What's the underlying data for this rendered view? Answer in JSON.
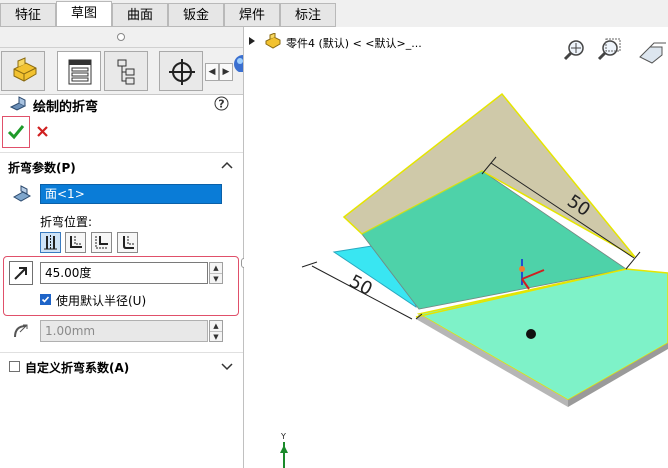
{
  "tabs": [
    "特征",
    "草图",
    "曲面",
    "钣金",
    "焊件",
    "标注"
  ],
  "active_tab": 1,
  "panel_tabs": [
    "part-icon",
    "property-icon",
    "config-icon",
    "target-icon",
    "appearance-icon"
  ],
  "feature": {
    "title": "绘制的折弯",
    "help_icon": "question-icon",
    "ok_icon": "check-icon",
    "cancel_icon": "close-icon"
  },
  "bend_params": {
    "header": "折弯参数(P)",
    "face_value": "面<1>",
    "position_label": "折弯位置:",
    "angle_value": "45.00度",
    "use_default_radius_label": "使用默认半径(U)",
    "use_default_radius": true,
    "radius_value": "1.00mm"
  },
  "custom_bend": {
    "label": "自定义折弯系数(A)",
    "checked": false
  },
  "viewport": {
    "breadcrumb": "零件4 (默认) < <默认>_...",
    "dimension_top": "50",
    "dimension_left": "50",
    "triad_label": "Y"
  },
  "colors": {
    "accent": "#0a7cd7",
    "highlight_border": "#e0506a",
    "green_face": "#4fd2a9",
    "light_green": "#7ef2c8",
    "tan_face": "#c7c09a",
    "cyan_face": "#39e6f2",
    "selection_yellow": "#f2f000"
  }
}
